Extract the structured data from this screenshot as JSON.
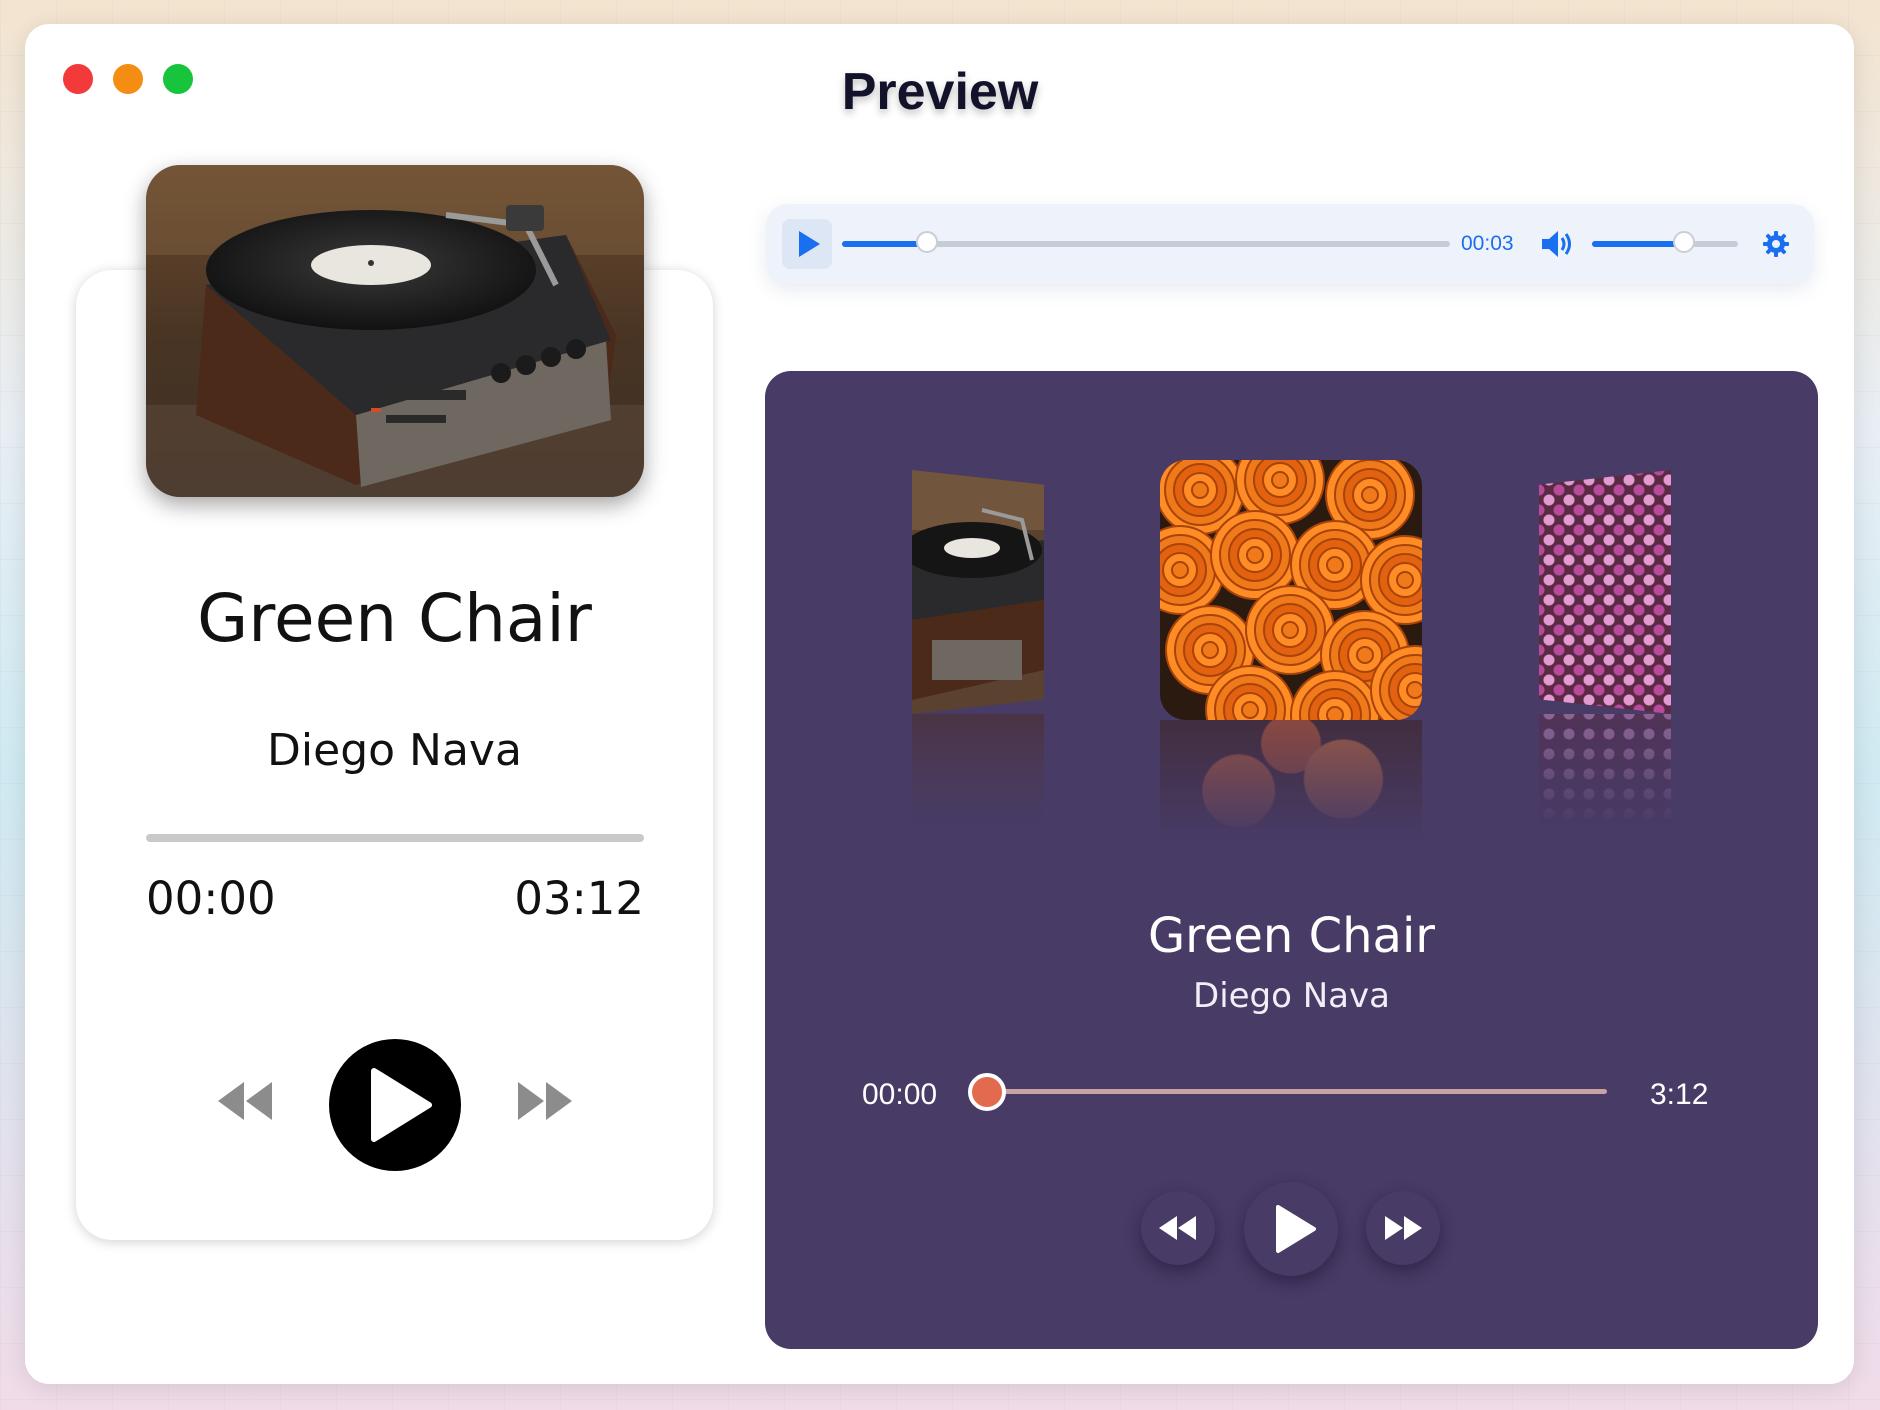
{
  "window": {
    "title": "Preview",
    "controls": [
      "close",
      "minimize",
      "maximize"
    ]
  },
  "card_player": {
    "track_title": "Green Chair",
    "artist": "Diego Nava",
    "current_time": "00:00",
    "duration": "03:12",
    "progress": 0,
    "artwork": "turntable-photo"
  },
  "audio_bar": {
    "time": "00:03",
    "progress": 0.14,
    "volume": 0.63,
    "icons": [
      "play-icon",
      "volume-icon",
      "settings-icon"
    ],
    "accent": "#1a6ff0"
  },
  "carousel_player": {
    "track_title": "Green Chair",
    "artist": "Diego Nava",
    "current_time": "00:00",
    "duration": "3:12",
    "progress": 0,
    "background": "#483b66",
    "accent": "#e26a4e",
    "slides": [
      "turntable",
      "orange-roses",
      "pink-flowers"
    ]
  }
}
